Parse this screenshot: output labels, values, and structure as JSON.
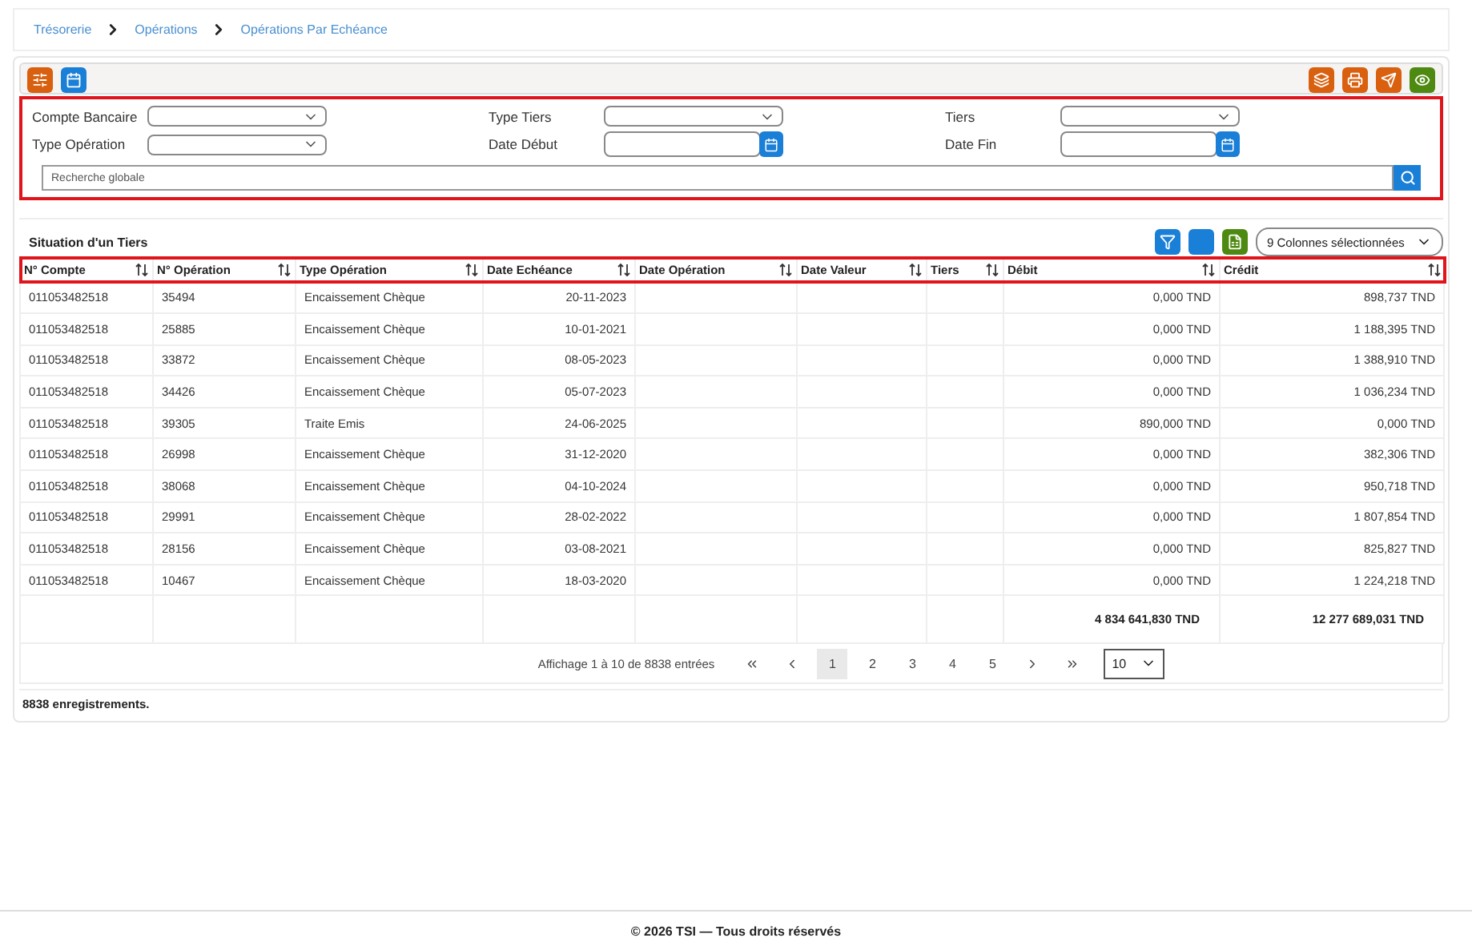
{
  "breadcrumb": [
    "Trésorerie",
    "Opérations",
    "Opérations Par Echéance"
  ],
  "toolbar": {
    "left": [
      {
        "kind": "sliders",
        "color": "#d9600f"
      },
      {
        "kind": "calendar",
        "color": "#1a7fd6"
      }
    ],
    "right": [
      {
        "kind": "stack",
        "color": "#d9600f"
      },
      {
        "kind": "printer",
        "color": "#d9600f"
      },
      {
        "kind": "send",
        "color": "#d9600f"
      },
      {
        "kind": "eye",
        "color": "#4e8a12"
      }
    ]
  },
  "filters": [
    {
      "label": "Compte Bancaire",
      "kind": "select"
    },
    {
      "label": "Type Tiers",
      "kind": "select"
    },
    {
      "label": "Tiers",
      "kind": "select"
    },
    {
      "label": "Type Opération",
      "kind": "select"
    },
    {
      "label": "Date Début",
      "kind": "date"
    },
    {
      "label": "Date Fin",
      "kind": "date"
    }
  ],
  "search": {
    "placeholder": "Recherche globale"
  },
  "table": {
    "title": "Situation d'un Tiers",
    "actions": [
      {
        "kind": "filter",
        "color": "#1a7fd6"
      },
      {
        "kind": "blank",
        "color": "#1a7fd6"
      },
      {
        "kind": "excel",
        "color": "#4e8a12"
      }
    ],
    "columns_select": "9 Colonnes sélectionnées",
    "columns": [
      "N° Compte",
      "N° Opération",
      "Type Opération",
      "Date Echéance",
      "Date Opération",
      "Date Valeur",
      "Tiers",
      "Débit",
      "Crédit"
    ],
    "rows": [
      [
        "011053482518",
        "35494",
        "Encaissement Chèque",
        "20-11-2023",
        null,
        null,
        null,
        "0,000 TND",
        "898,737 TND"
      ],
      [
        "011053482518",
        "25885",
        "Encaissement Chèque",
        "10-01-2021",
        null,
        null,
        null,
        "0,000 TND",
        "1 188,395 TND"
      ],
      [
        "011053482518",
        "33872",
        "Encaissement Chèque",
        "08-05-2023",
        null,
        null,
        null,
        "0,000 TND",
        "1 388,910 TND"
      ],
      [
        "011053482518",
        "34426",
        "Encaissement Chèque",
        "05-07-2023",
        null,
        null,
        null,
        "0,000 TND",
        "1 036,234 TND"
      ],
      [
        "011053482518",
        "39305",
        "Traite Emis",
        "24-06-2025",
        null,
        null,
        null,
        "890,000 TND",
        "0,000 TND"
      ],
      [
        "011053482518",
        "26998",
        "Encaissement Chèque",
        "31-12-2020",
        null,
        null,
        null,
        "0,000 TND",
        "382,306 TND"
      ],
      [
        "011053482518",
        "38068",
        "Encaissement Chèque",
        "04-10-2024",
        null,
        null,
        null,
        "0,000 TND",
        "950,718 TND"
      ],
      [
        "011053482518",
        "29991",
        "Encaissement Chèque",
        "28-02-2022",
        null,
        null,
        null,
        "0,000 TND",
        "1 807,854 TND"
      ],
      [
        "011053482518",
        "28156",
        "Encaissement Chèque",
        "03-08-2021",
        null,
        null,
        null,
        "0,000 TND",
        "825,827 TND"
      ],
      [
        "011053482518",
        "10467",
        "Encaissement Chèque",
        "18-03-2020",
        null,
        null,
        null,
        "0,000 TND",
        "1 224,218 TND"
      ]
    ],
    "totals": {
      "debit": "4 834 641,830 TND",
      "credit": "12 277 689,031 TND"
    }
  },
  "pagination": {
    "summary": "Affichage 1 à 10 de 8838 entrées",
    "pages": [
      {
        "label": "1",
        "selected": true
      },
      {
        "label": "2",
        "selected": false
      },
      {
        "label": "3",
        "selected": false
      },
      {
        "label": "4",
        "selected": false
      },
      {
        "label": "5",
        "selected": false
      }
    ],
    "page_size": "10"
  },
  "record_count": "8838 enregistrements.",
  "footer": "© 2026 TSI — Tous droits réservés"
}
